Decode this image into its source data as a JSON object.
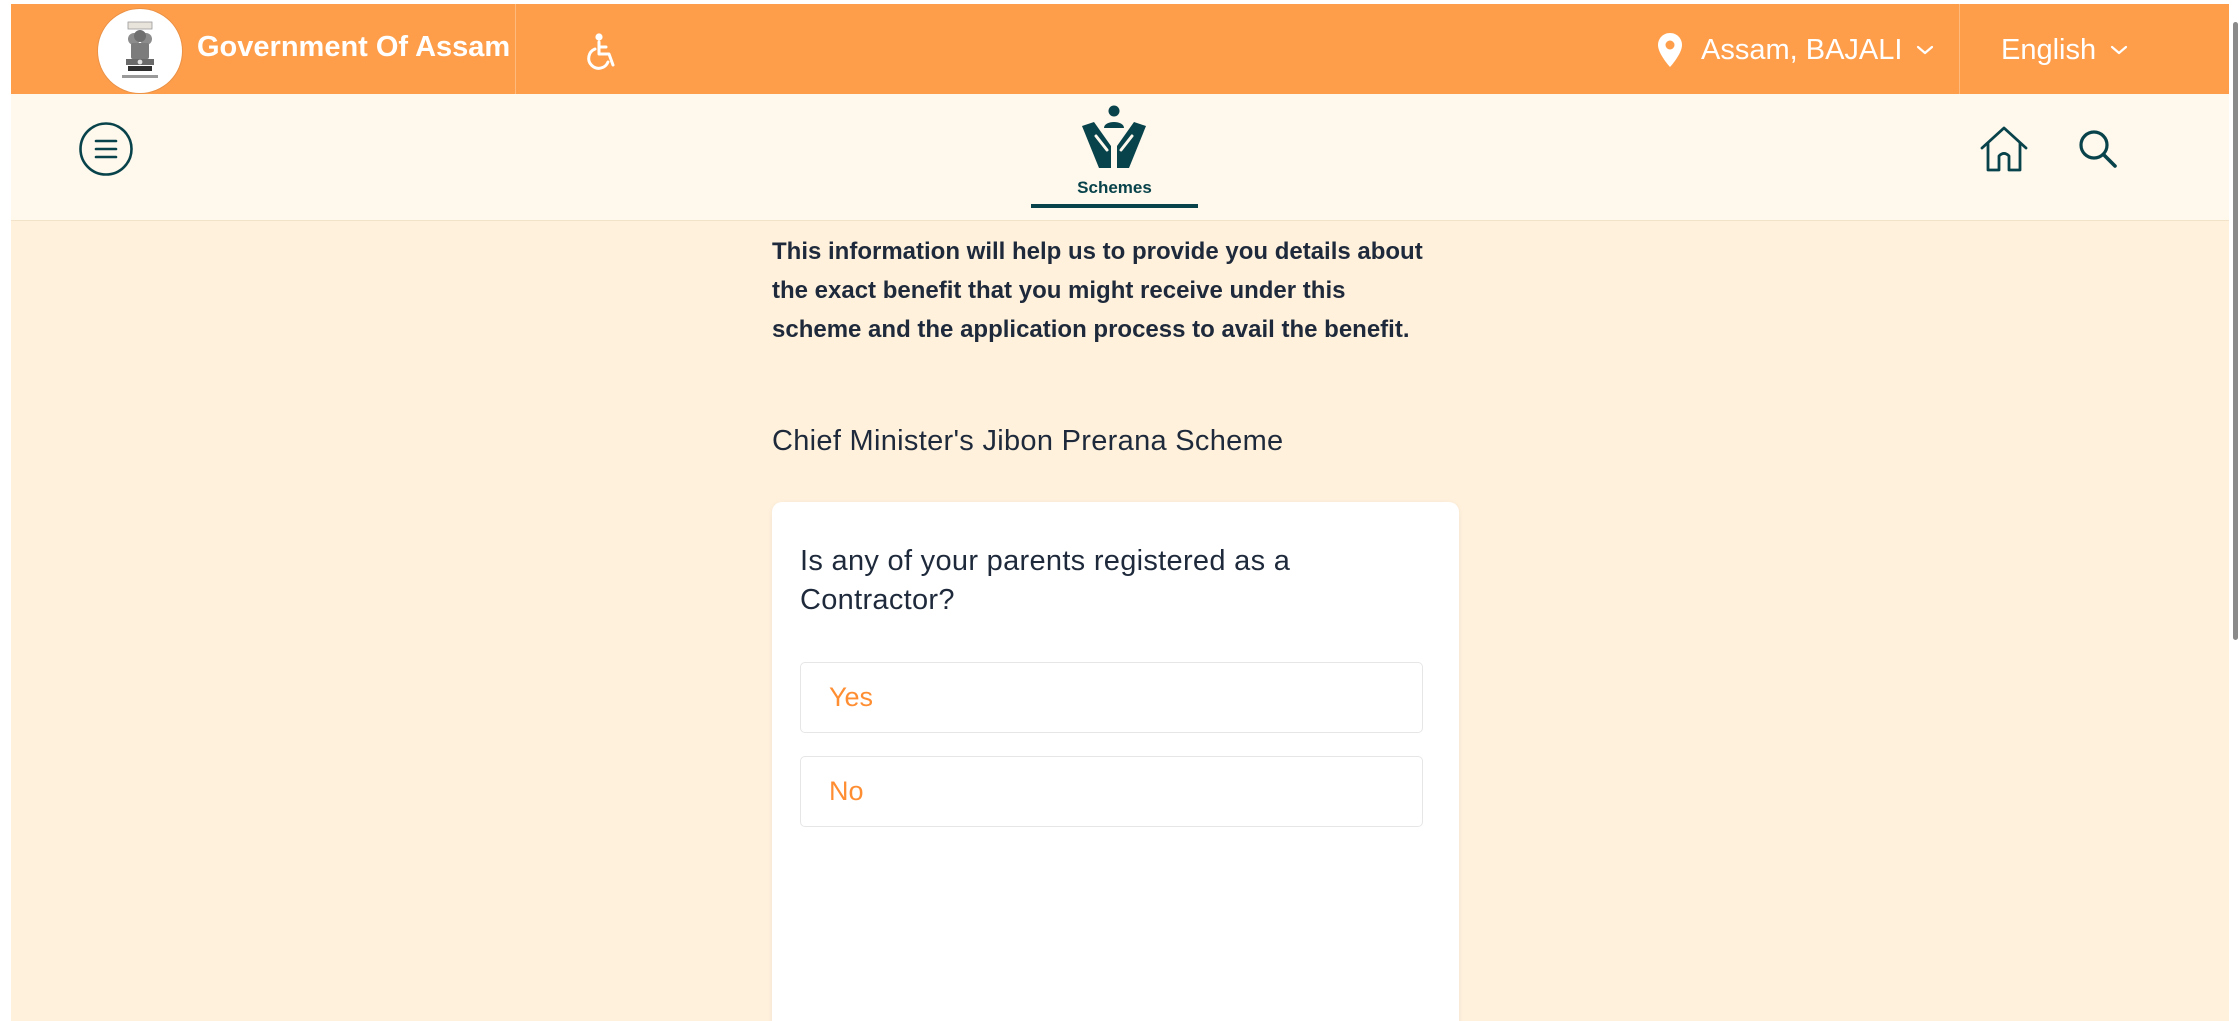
{
  "header": {
    "gov_title": "Government Of Assam",
    "location": "Assam, BAJALI",
    "language": "English"
  },
  "nav": {
    "schemes_label": "Schemes"
  },
  "content": {
    "intro_lines": [
      "This information will help us to provide you details about",
      "the exact benefit that you might receive under this",
      "scheme and the application process to avail the benefit."
    ],
    "scheme_title": "Chief Minister's Jibon Prerana Scheme",
    "question_lines": [
      "Is any of your parents registered as a",
      "Contractor?"
    ],
    "options": [
      "Yes",
      "No"
    ]
  },
  "colors": {
    "topbar": "#fe9e4b",
    "page_bg": "#fff1dc",
    "subbar_bg": "#fff8ec",
    "brand_teal": "#08434b",
    "option_text": "#ff8e33",
    "text_dark": "#1e2a3b"
  }
}
